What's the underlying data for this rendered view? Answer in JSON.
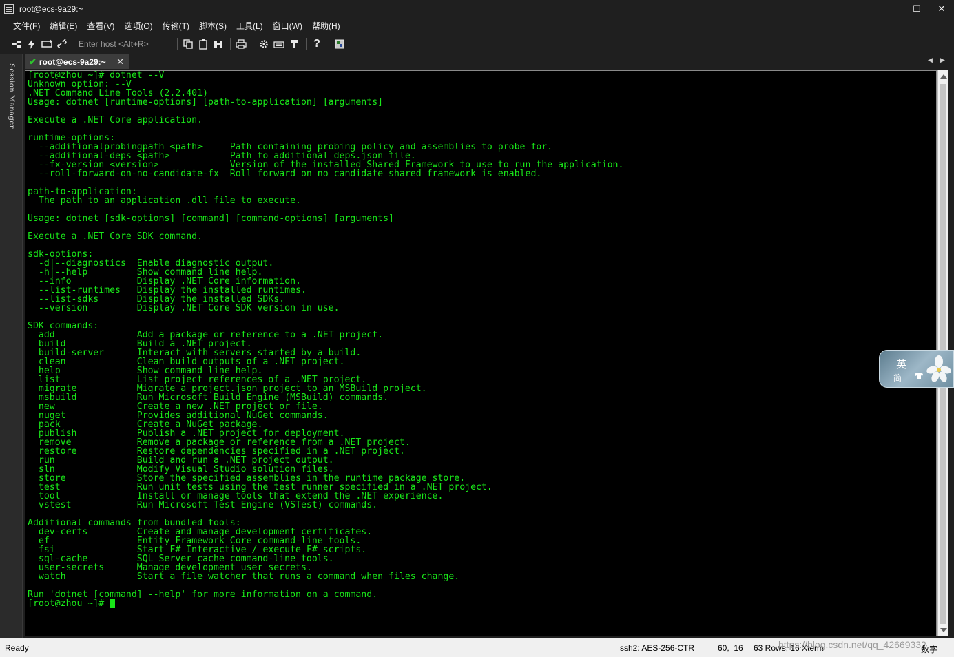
{
  "window": {
    "title": "root@ecs-9a29:~"
  },
  "window_controls": {
    "minimize": "—",
    "maximize": "☐",
    "close": "✕"
  },
  "menu": [
    "文件(F)",
    "编辑(E)",
    "查看(V)",
    "选项(O)",
    "传输(T)",
    "脚本(S)",
    "工具(L)",
    "窗口(W)",
    "帮助(H)"
  ],
  "toolbar": {
    "host_placeholder": "Enter host <Alt+R>",
    "icons": [
      "connect-icon",
      "quick-connect-icon",
      "reconnect-icon",
      "disconnect-icon",
      "copy-icon",
      "paste-icon",
      "find-icon",
      "print-icon",
      "settings-icon",
      "keymap-icon",
      "sftp-icon",
      "help-icon",
      "script-icon"
    ]
  },
  "session_manager": {
    "label": "Session Manager"
  },
  "tabs": [
    {
      "label": "root@ecs-9a29:~",
      "close": "✕"
    }
  ],
  "terminal": {
    "lines": [
      "[root@zhou ~]# dotnet --V",
      "Unknown option: --V",
      ".NET Command Line Tools (2.2.401)",
      "Usage: dotnet [runtime-options] [path-to-application] [arguments]",
      "",
      "Execute a .NET Core application.",
      "",
      "runtime-options:",
      "  --additionalprobingpath <path>     Path containing probing policy and assemblies to probe for.",
      "  --additional-deps <path>           Path to additional deps.json file.",
      "  --fx-version <version>             Version of the installed Shared Framework to use to run the application.",
      "  --roll-forward-on-no-candidate-fx  Roll forward on no candidate shared framework is enabled.",
      "",
      "path-to-application:",
      "  The path to an application .dll file to execute.",
      "",
      "Usage: dotnet [sdk-options] [command] [command-options] [arguments]",
      "",
      "Execute a .NET Core SDK command.",
      "",
      "sdk-options:",
      "  -d|--diagnostics  Enable diagnostic output.",
      "  -h|--help         Show command line help.",
      "  --info            Display .NET Core information.",
      "  --list-runtimes   Display the installed runtimes.",
      "  --list-sdks       Display the installed SDKs.",
      "  --version         Display .NET Core SDK version in use.",
      "",
      "SDK commands:",
      "  add               Add a package or reference to a .NET project.",
      "  build             Build a .NET project.",
      "  build-server      Interact with servers started by a build.",
      "  clean             Clean build outputs of a .NET project.",
      "  help              Show command line help.",
      "  list              List project references of a .NET project.",
      "  migrate           Migrate a project.json project to an MSBuild project.",
      "  msbuild           Run Microsoft Build Engine (MSBuild) commands.",
      "  new               Create a new .NET project or file.",
      "  nuget             Provides additional NuGet commands.",
      "  pack              Create a NuGet package.",
      "  publish           Publish a .NET project for deployment.",
      "  remove            Remove a package or reference from a .NET project.",
      "  restore           Restore dependencies specified in a .NET project.",
      "  run               Build and run a .NET project output.",
      "  sln               Modify Visual Studio solution files.",
      "  store             Store the specified assemblies in the runtime package store.",
      "  test              Run unit tests using the test runner specified in a .NET project.",
      "  tool              Install or manage tools that extend the .NET experience.",
      "  vstest            Run Microsoft Test Engine (VSTest) commands.",
      "",
      "Additional commands from bundled tools:",
      "  dev-certs         Create and manage development certificates.",
      "  ef                Entity Framework Core command-line tools.",
      "  fsi               Start F# Interactive / execute F# scripts.",
      "  sql-cache         SQL Server cache command-line tools.",
      "  user-secrets      Manage development user secrets.",
      "  watch             Start a file watcher that runs a command when files change.",
      "",
      "Run 'dotnet [command] --help' for more information on a command."
    ],
    "prompt": "[root@zhou ~]# ",
    "text_color": "#19e619",
    "background": "#000000"
  },
  "ime": {
    "lang": "英",
    "mode": "简"
  },
  "status": {
    "ready": "Ready",
    "cipher": "ssh2: AES-256-CTR",
    "cursor_pos": "60,  16",
    "dimensions": "63 Rows, 16 Xterm",
    "num": "数字",
    "watermark": "https://blog.csdn.net/qq_42669332"
  }
}
